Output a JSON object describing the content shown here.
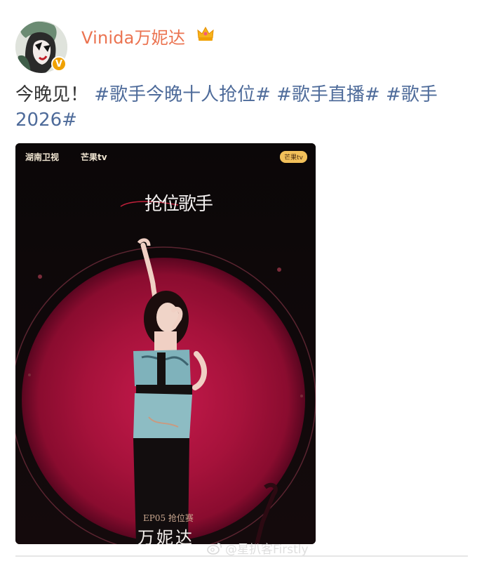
{
  "post": {
    "username": "Vinida万妮达",
    "text_plain": "今晚见！",
    "hashtags": [
      "#歌手今晚十人抢位#",
      "#歌手直播#",
      "#歌手2026#"
    ]
  },
  "poster": {
    "logo_left": "湖南卫视",
    "logo_mid": "芒果tv",
    "logo_right": "芒果tv",
    "show_title_line1": "抢位",
    "show_title_line2": "歌手",
    "episode": "EP05 抢位赛",
    "singer": "万妮达"
  },
  "watermark": {
    "text": "@星扒客Firstly"
  },
  "icons": {
    "avatar": "avatar",
    "verified": "verified-badge-icon",
    "crown": "crown-icon",
    "weibo": "weibo-icon"
  },
  "colors": {
    "username": "#eb7350",
    "hashtag": "#4e6b9a",
    "spotlight": "#b3133e",
    "poster_bg": "#0b0708"
  }
}
